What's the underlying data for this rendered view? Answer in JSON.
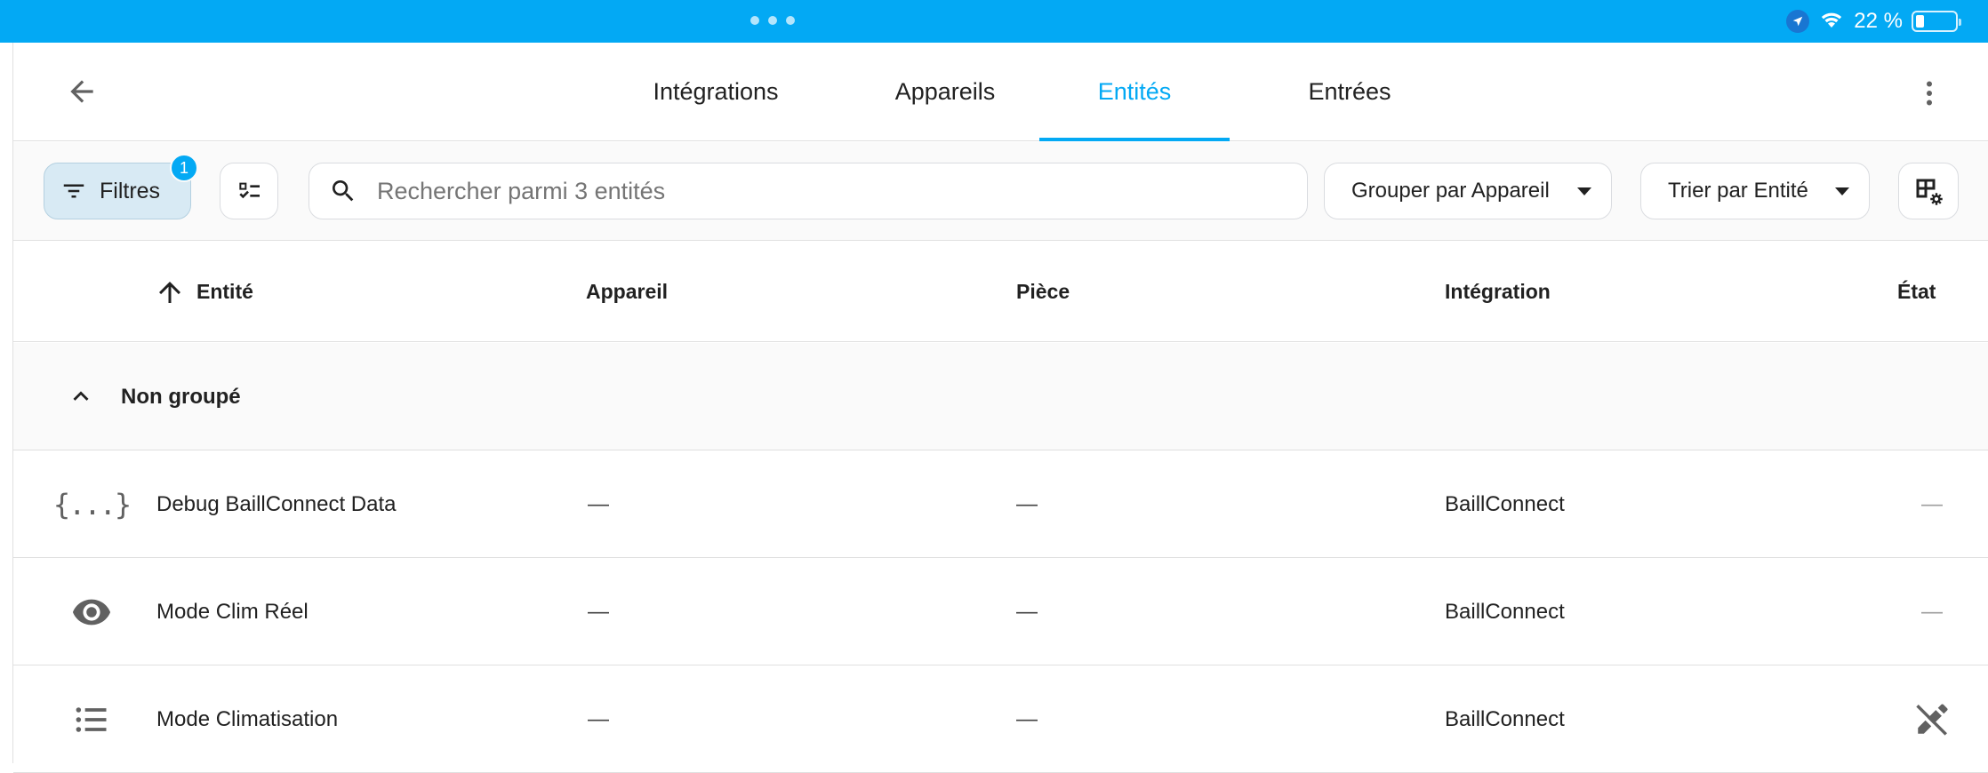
{
  "status_bar": {
    "battery_text": "22 %",
    "battery_level": 0.22,
    "icons": [
      "location-arrow-icon",
      "wifi-icon",
      "battery-icon"
    ],
    "multitask_icon": "more-dots-icon"
  },
  "header": {
    "back_icon": "arrow-left-icon",
    "tabs": [
      {
        "label": "Intégrations",
        "active": false
      },
      {
        "label": "Appareils",
        "active": false
      },
      {
        "label": "Entités",
        "active": true
      },
      {
        "label": "Entrées",
        "active": false
      }
    ],
    "overflow_icon": "more-vertical-icon"
  },
  "toolbar": {
    "filters_label": "Filtres",
    "filters_count": "1",
    "search_placeholder": "Rechercher parmi 3 entités",
    "search_value": "",
    "group_by_label": "Grouper par Appareil",
    "sort_by_label": "Trier par Entité"
  },
  "table": {
    "columns": {
      "entity": "Entité",
      "device": "Appareil",
      "area": "Pièce",
      "integration": "Intégration",
      "state": "État"
    },
    "sort_direction": "ascending",
    "group": {
      "label": "Non groupé",
      "expanded": true
    },
    "rows": [
      {
        "icon": "code-braces-icon",
        "icon_text": "{...}",
        "name": "Debug BaillConnect Data",
        "device": "—",
        "area": "—",
        "integration": "BaillConnect",
        "state": "—"
      },
      {
        "icon": "eye-icon",
        "name": "Mode Clim Réel",
        "device": "—",
        "area": "—",
        "integration": "BaillConnect",
        "state": "—"
      },
      {
        "icon": "format-list-bulleted-icon",
        "name": "Mode Climatisation",
        "device": "—",
        "area": "—",
        "integration": "BaillConnect",
        "state_icon": "pencil-off-icon"
      }
    ]
  },
  "colors": {
    "accent": "#03a9f4",
    "status_bar": "#03a9f4",
    "filter_button_bg": "#d8eaf4",
    "text": "#212121"
  }
}
